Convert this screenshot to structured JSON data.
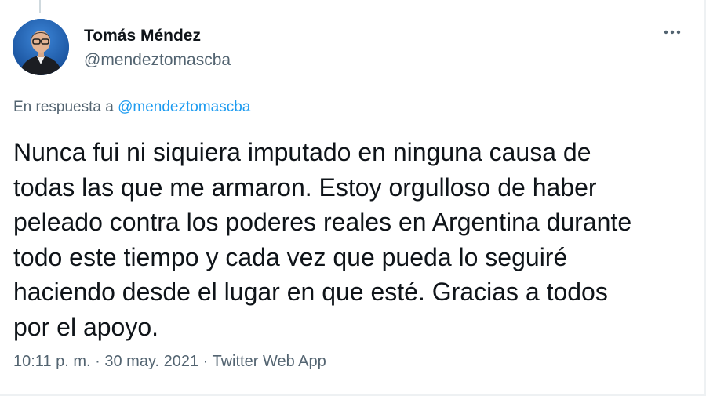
{
  "tweet": {
    "author": {
      "name": "Tomás Méndez",
      "handle": "@mendeztomascba"
    },
    "more_icon": "more-horizontal-icon",
    "reply_prefix": "En respuesta a ",
    "reply_to_handle": "@mendeztomascba",
    "text": "Nunca fui ni siquiera imputado en ninguna causa de\ntodas las que me armaron. Estoy orgulloso de haber\npeleado contra los poderes reales en Argentina durante\ntodo este tiempo y cada vez que pueda lo seguiré\nhaciendo desde el lugar en que esté. Gracias a todos\npor el apoyo.",
    "time": "10:11 p. m.",
    "separator": " · ",
    "date": "30 may. 2021",
    "source": "Twitter Web App"
  },
  "colors": {
    "text": "#0f1419",
    "secondary": "#536471",
    "link": "#1d9bf0",
    "avatar_bg": "#1e5fb4"
  }
}
